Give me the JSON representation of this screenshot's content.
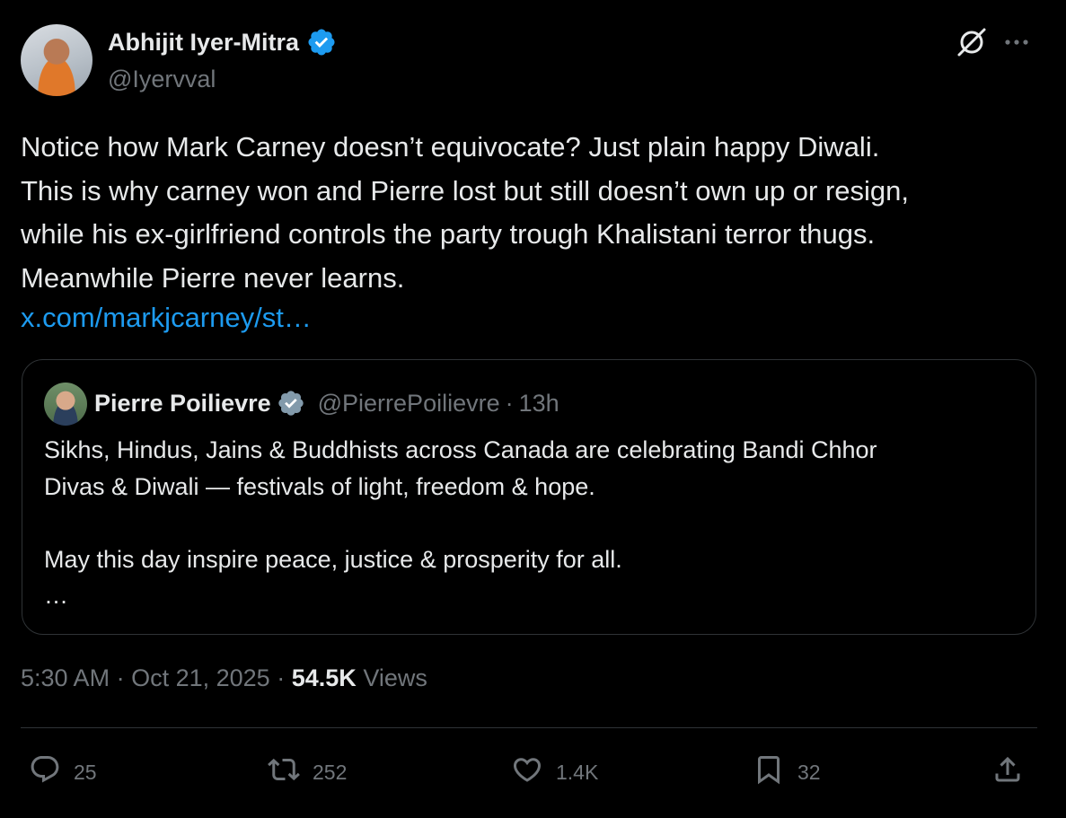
{
  "author": {
    "name": "Abhijit Iyer-Mitra",
    "handle": "@Iyervval"
  },
  "tweet": {
    "text": "Notice how Mark Carney doesn’t equivocate? Just plain happy Diwali.\nThis is why carney won and Pierre lost but still doesn’t own up or resign,\nwhile his ex-girlfriend controls the party trough Khalistani terror thugs.\nMeanwhile Pierre never learns.",
    "link": "x.com/markjcarney/st…"
  },
  "quote": {
    "name": "Pierre Poilievre",
    "handle": "@PierrePoilievre",
    "dot": "·",
    "time": "13h",
    "text": "Sikhs, Hindus, Jains & Buddhists across Canada are celebrating Bandi Chhor\nDivas & Diwali — festivals of light, freedom & hope.\n\nMay this day inspire peace, justice & prosperity for all.\n…"
  },
  "meta": {
    "time": "5:30 AM",
    "sep1": "·",
    "date": "Oct 21, 2025",
    "sep2": "·",
    "views_count": "54.5K",
    "views_label": "Views"
  },
  "actions": {
    "replies": "25",
    "reposts": "252",
    "likes": "1.4K",
    "bookmarks": "32"
  },
  "icons": {
    "verified": "verified-badge-icon",
    "grok": "grok-icon",
    "more": "more-icon",
    "reply": "reply-icon",
    "repost": "repost-icon",
    "like": "heart-icon",
    "bookmark": "bookmark-icon",
    "share": "share-icon"
  },
  "colors": {
    "background": "#000000",
    "text": "#e7e9ea",
    "secondary": "#71767b",
    "link": "#1d9bf0",
    "verified_blue": "#1d9bf0",
    "verified_gray": "#829aab",
    "border": "#2f3336"
  }
}
